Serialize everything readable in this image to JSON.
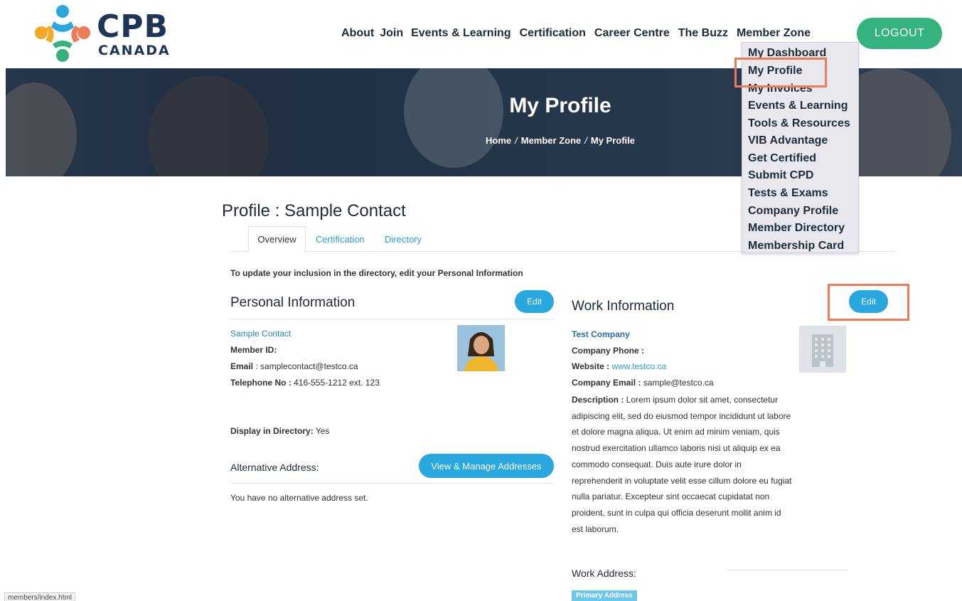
{
  "brand": {
    "name": "CPB",
    "sub": "CANADA"
  },
  "nav": {
    "items": [
      "About",
      "Join",
      "Events & Learning",
      "Certification",
      "Career Centre",
      "The Buzz",
      "Member Zone"
    ],
    "logout": "LOGOUT"
  },
  "hero": {
    "title": "My Profile",
    "crumbs": [
      "Home",
      "Member Zone",
      "My Profile"
    ],
    "sep": "/"
  },
  "dropdown": {
    "items": [
      "My Dashboard",
      "My Profile",
      "My Invoices",
      "Events & Learning",
      "Tools & Resources",
      "VIB Advantage",
      "Get Certified",
      "Submit CPD",
      "Tests & Exams",
      "Company Profile",
      "Member Directory",
      "Membership Card"
    ]
  },
  "profile": {
    "title": "Profile : Sample Contact",
    "tabs": [
      "Overview",
      "Certification",
      "Directory"
    ],
    "notice": "To update your inclusion in the directory, edit your Personal Information"
  },
  "personal": {
    "heading": "Personal Information",
    "edit": "Edit",
    "name": "Sample Contact",
    "member_id_label": "Member ID:",
    "member_id_value": "",
    "email_label": "Email",
    "email_value": ": samplecontact@testco.ca",
    "phone_label": "Telephone No :",
    "phone_value": " 416-555-1212 ext. 123",
    "directory_label": "Display in Directory:",
    "directory_value": " Yes",
    "alt_heading": "Alternative Address:",
    "alt_button": "View & Manage Addresses",
    "alt_none": "You have no alternative address set."
  },
  "work": {
    "heading": "Work Information",
    "edit": "Edit",
    "company": "Test Company",
    "phone_label": "Company Phone :",
    "phone_value": "",
    "website_label": "Website :",
    "website_value": " www.testco.ca",
    "email_label": "Company Email :",
    "email_value": " sample@testco.ca",
    "desc_label": "Description :",
    "desc_value": " Lorem ipsum dolor sit amet, consectetur adipiscing elit, sed do eiusmod tempor incididunt ut labore et dolore magna aliqua. Ut enim ad minim veniam, quis nostrud exercitation ullamco laboris nisi ut aliquip ex ea commodo consequat. Duis aute irure dolor in reprehenderit in voluptate velit esse cillum dolore eu fugiat nulla pariatur. Excepteur sint occaecat cupidatat non proident, sunt in culpa qui officia deserunt mollit anim id est laborum.",
    "address_heading": "Work Address:",
    "primary_badge": "Primary Address"
  },
  "statusbar": {
    "url": "members/index.html"
  },
  "colors": {
    "accent": "#29a8e0",
    "logout": "#35b37e",
    "highlight": "#f07b59",
    "navy": "#1f3556"
  }
}
